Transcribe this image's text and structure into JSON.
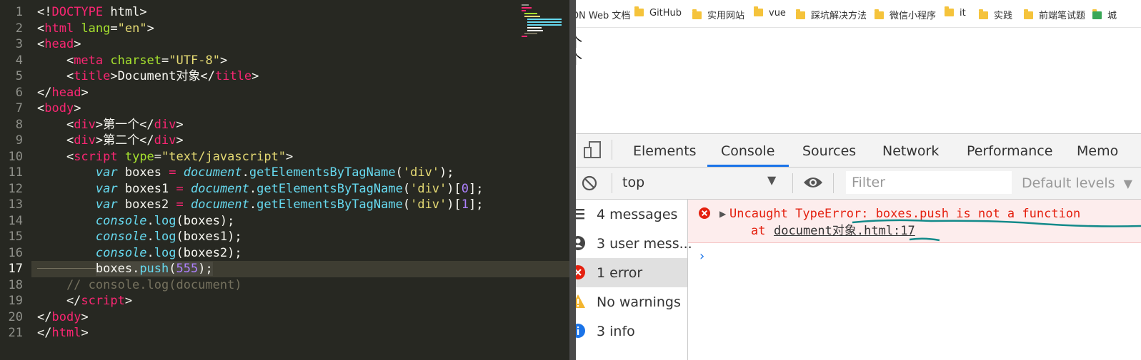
{
  "editor": {
    "lines": [
      {
        "num": "1"
      },
      {
        "num": "2"
      },
      {
        "num": "3"
      },
      {
        "num": "4"
      },
      {
        "num": "5"
      },
      {
        "num": "6"
      },
      {
        "num": "7"
      },
      {
        "num": "8"
      },
      {
        "num": "9"
      },
      {
        "num": "10"
      },
      {
        "num": "11"
      },
      {
        "num": "12"
      },
      {
        "num": "13"
      },
      {
        "num": "14"
      },
      {
        "num": "15"
      },
      {
        "num": "16"
      },
      {
        "num": "17"
      },
      {
        "num": "18"
      },
      {
        "num": "19"
      },
      {
        "num": "20"
      },
      {
        "num": "21"
      }
    ],
    "code": {
      "l1_a": "<!",
      "l1_b": "DOCTYPE",
      "l1_c": " html>",
      "l2_a": "<",
      "l2_tag": "html",
      "l2_attr": " lang",
      "l2_eq": "=",
      "l2_val": "\"en\"",
      "l2_end": ">",
      "l3_a": "<",
      "l3_tag": "head",
      "l3_end": ">",
      "l4_a": "    <",
      "l4_tag": "meta",
      "l4_attr": " charset",
      "l4_eq": "=",
      "l4_val": "\"UTF-8\"",
      "l4_end": ">",
      "l5_a": "    <",
      "l5_tag": "title",
      "l5_mid": ">Document对象</",
      "l5_tag2": "title",
      "l5_end": ">",
      "l6_a": "</",
      "l6_tag": "head",
      "l6_end": ">",
      "l7_a": "<",
      "l7_tag": "body",
      "l7_end": ">",
      "l8_a": "    <",
      "l8_tag": "div",
      "l8_mid": ">第一个</",
      "l8_tag2": "div",
      "l8_end": ">",
      "l9_a": "    <",
      "l9_tag": "div",
      "l9_mid": ">第二个</",
      "l9_tag2": "div",
      "l9_end": ">",
      "l10_a": "    <",
      "l10_tag": "script",
      "l10_attr": " type",
      "l10_eq": "=",
      "l10_val": "\"text/javascript\"",
      "l10_end": ">",
      "l11_indent": "        ",
      "l11_var": "var",
      "l11_name": " boxes ",
      "l11_op": "=",
      "l11_sp": " ",
      "l11_doc": "document",
      "l11_dot": ".",
      "l11_fn": "getElementsByTagName",
      "l11_p1": "(",
      "l11_str": "'div'",
      "l11_p2": ");",
      "l12_indent": "        ",
      "l12_var": "var",
      "l12_name": " boxes1 ",
      "l12_op": "=",
      "l12_sp": " ",
      "l12_doc": "document",
      "l12_dot": ".",
      "l12_fn": "getElementsByTagName",
      "l12_p1": "(",
      "l12_str": "'div'",
      "l12_p2": ")[",
      "l12_num": "0",
      "l12_p3": "];",
      "l13_indent": "        ",
      "l13_var": "var",
      "l13_name": " boxes2 ",
      "l13_op": "=",
      "l13_sp": " ",
      "l13_doc": "document",
      "l13_dot": ".",
      "l13_fn": "getElementsByTagName",
      "l13_p1": "(",
      "l13_str": "'div'",
      "l13_p2": ")[",
      "l13_num": "1",
      "l13_p3": "];",
      "l14_indent": "        ",
      "l14_obj": "console",
      "l14_dot": ".",
      "l14_fn": "log",
      "l14_rest": "(boxes);",
      "l15_indent": "        ",
      "l15_obj": "console",
      "l15_dot": ".",
      "l15_fn": "log",
      "l15_rest": "(boxes1);",
      "l16_indent": "        ",
      "l16_obj": "console",
      "l16_dot": ".",
      "l16_fn": "log",
      "l16_rest": "(boxes2);",
      "l17_indent": "        ",
      "l17_a": "boxes.",
      "l17_fn": "push",
      "l17_p1": "(",
      "l17_num": "555",
      "l17_p2": ");",
      "l18_text": "    // console.log(document)",
      "l19_a": "    </",
      "l19_tag": "script",
      "l19_end": ">",
      "l20_a": "</",
      "l20_tag": "body",
      "l20_end": ">",
      "l21_a": "</",
      "l21_tag": "html",
      "l21_end": ">"
    }
  },
  "bookmarks": [
    {
      "label": "DN Web 文档"
    },
    {
      "label": "GitHub"
    },
    {
      "label": "实用网站"
    },
    {
      "label": "vue"
    },
    {
      "label": "踩坑解决方法"
    },
    {
      "label": "微信小程序"
    },
    {
      "label": "it"
    },
    {
      "label": "实践"
    },
    {
      "label": "前端笔试题"
    },
    {
      "label": "城"
    }
  ],
  "page": {
    "line1": "个",
    "line2": "个"
  },
  "devtools": {
    "tabs": [
      "Elements",
      "Console",
      "Sources",
      "Network",
      "Performance",
      "Memo"
    ],
    "active_tab": "Console",
    "context": "top",
    "filter_placeholder": "Filter",
    "levels": "Default levels",
    "sidebar": [
      {
        "label": "4 messages",
        "icon": "list-icon"
      },
      {
        "label": "3 user mess...",
        "icon": "user-icon"
      },
      {
        "label": "1 error",
        "icon": "error-icon"
      },
      {
        "label": "No warnings",
        "icon": "warning-icon"
      },
      {
        "label": "3 info",
        "icon": "info-icon"
      }
    ],
    "error": {
      "message": "Uncaught TypeError: boxes.push is not a function",
      "at": "at",
      "location": "document对象.html:17"
    }
  },
  "colors": {
    "editor_bg": "#272822",
    "error_red": "#e4200f",
    "error_bg": "#fdeded",
    "devtools_accent": "#1a73e8",
    "annotation_teal": "#138a8a"
  }
}
